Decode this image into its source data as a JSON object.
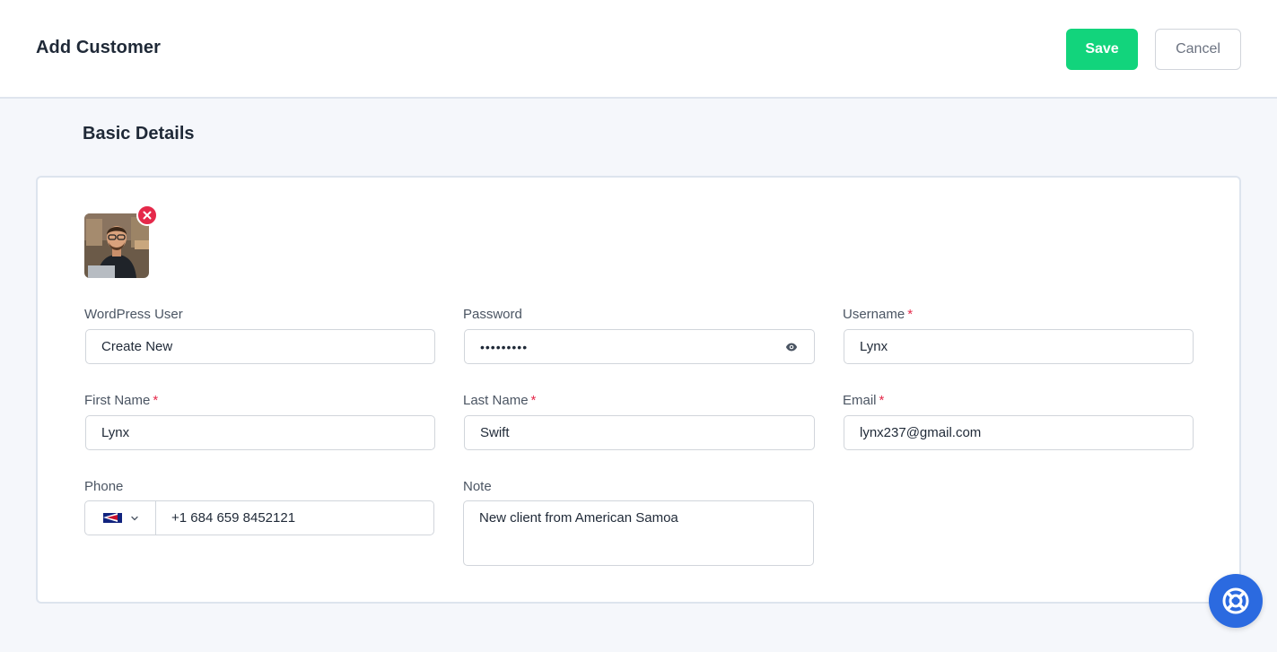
{
  "header": {
    "title": "Add Customer",
    "save_label": "Save",
    "cancel_label": "Cancel"
  },
  "section": {
    "title": "Basic Details"
  },
  "form": {
    "wordpress_user": {
      "label": "WordPress User",
      "value": "Create New"
    },
    "password": {
      "label": "Password",
      "value": "•••••••••"
    },
    "username": {
      "label": "Username",
      "required": "*",
      "value": "Lynx"
    },
    "first_name": {
      "label": "First Name",
      "required": "*",
      "value": "Lynx"
    },
    "last_name": {
      "label": "Last Name",
      "required": "*",
      "value": "Swift"
    },
    "email": {
      "label": "Email",
      "required": "*",
      "value": "lynx237@gmail.com"
    },
    "phone": {
      "label": "Phone",
      "value": "+1 684 659 8452121",
      "country_flag": "american-samoa-flag"
    },
    "note": {
      "label": "Note",
      "value": "New client from American Samoa"
    }
  },
  "icons": {
    "remove_avatar": "close-icon",
    "password_toggle": "eye-icon",
    "country_dropdown": "chevron-down-icon",
    "help": "lifebuoy-icon"
  },
  "colors": {
    "accent_save": "#12d47c",
    "required": "#e5294a",
    "help_fab": "#2b6ae0"
  }
}
